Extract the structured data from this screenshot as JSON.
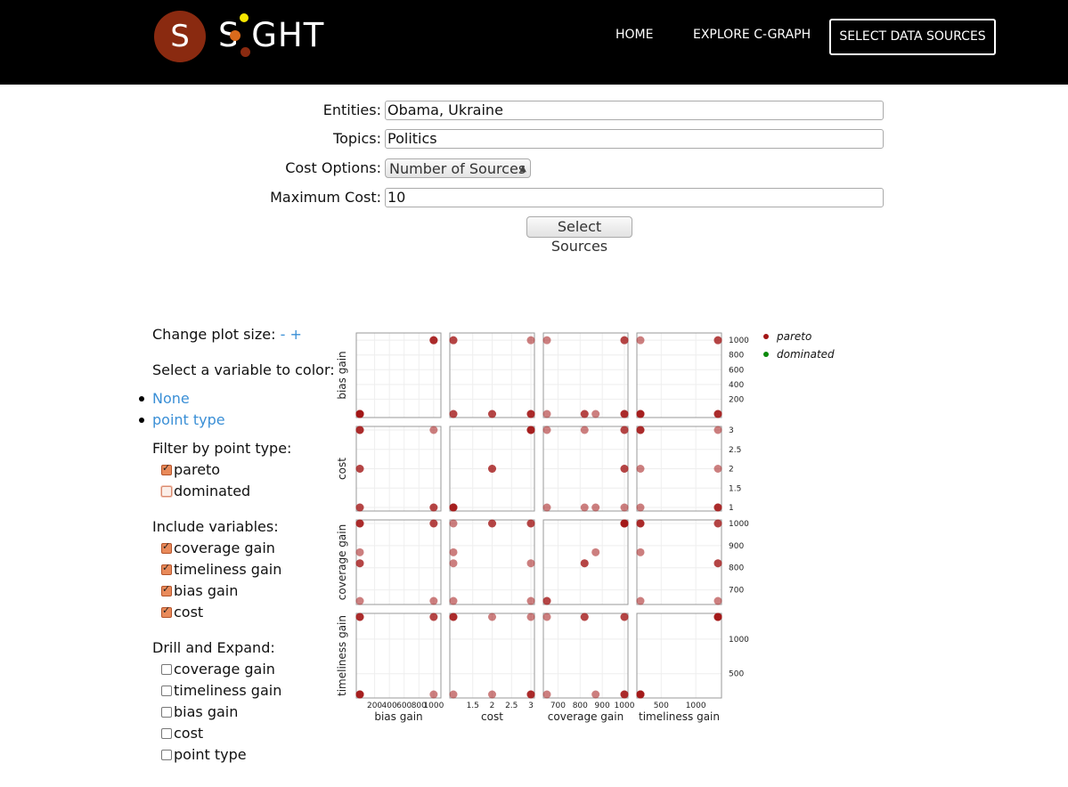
{
  "header": {
    "logo_letter": "S",
    "logo_text": "S GHT",
    "nav": [
      "HOME",
      "EXPLORE C-GRAPH",
      "SELECT DATA SOURCES"
    ]
  },
  "form": {
    "entities_label": "Entities:",
    "entities_value": "Obama, Ukraine",
    "topics_label": "Topics:",
    "topics_value": "Politics",
    "cost_label": "Cost Options:",
    "cost_value": "Number of Sources",
    "max_cost_label": "Maximum Cost:",
    "max_cost_value": "10",
    "submit_label": "Select Sources"
  },
  "controls": {
    "plot_size_label": "Change plot size:",
    "minus": "-",
    "plus": "+",
    "color_label": "Select a variable to color:",
    "color_options": [
      "None",
      "point type"
    ],
    "filter_label": "Filter by point type:",
    "filter_options": [
      {
        "label": "pareto",
        "checked": true
      },
      {
        "label": "dominated",
        "checked": false
      }
    ],
    "include_label": "Include variables:",
    "include_options": [
      {
        "label": "coverage gain",
        "checked": true
      },
      {
        "label": "timeliness gain",
        "checked": true
      },
      {
        "label": "bias gain",
        "checked": true
      },
      {
        "label": "cost",
        "checked": true
      }
    ],
    "drill_label": "Drill and Expand:",
    "drill_options": [
      {
        "label": "coverage gain",
        "checked": false
      },
      {
        "label": "timeliness gain",
        "checked": false
      },
      {
        "label": "bias gain",
        "checked": false
      },
      {
        "label": "cost",
        "checked": false
      },
      {
        "label": "point type",
        "checked": false
      }
    ]
  },
  "legend": [
    {
      "label": "pareto",
      "color": "#a31515"
    },
    {
      "label": "dominated",
      "color": "#0d8a0d"
    }
  ],
  "chart_data": {
    "type": "scatter",
    "variables": [
      "bias gain",
      "cost",
      "coverage gain",
      "timeliness gain"
    ],
    "ranges": [
      [
        0,
        1050
      ],
      [
        1,
        3
      ],
      [
        650,
        1000
      ],
      [
        200,
        1320
      ]
    ],
    "x_ticks": [
      [
        200,
        400,
        600,
        800,
        1000
      ],
      [
        1.5,
        2,
        2.5,
        3
      ],
      [
        700,
        800,
        900,
        1000
      ],
      [
        500,
        1000
      ]
    ],
    "y_ticks": [
      [
        200,
        400,
        600,
        800,
        1000
      ],
      [
        1,
        1.5,
        2,
        2.5,
        3
      ],
      [
        700,
        800,
        900,
        1000
      ],
      [
        500,
        1000
      ]
    ],
    "x_tick_labels": [
      [
        "200",
        "400",
        "600",
        "800",
        "1000"
      ],
      [
        "1.5",
        "2",
        "2.5",
        "3"
      ],
      [
        "700",
        "800",
        "900",
        "1000"
      ],
      [
        "500",
        "1000"
      ]
    ],
    "y_tick_labels": [
      [
        "200",
        "400",
        "600",
        "800",
        "1000"
      ],
      [
        "1",
        "1.5",
        "2",
        "2.5",
        "3"
      ],
      [
        "700",
        "800",
        "900",
        "1000"
      ],
      [
        "500",
        "1000"
      ]
    ],
    "pareto_color": "#a31515",
    "points": [
      {
        "bias gain": 1000,
        "cost": 1,
        "coverage gain": 1000,
        "timeliness gain": 1320,
        "point_type": "pareto"
      },
      {
        "bias gain": 0,
        "cost": 2,
        "coverage gain": 1000,
        "timeliness gain": 1320,
        "point_type": "pareto"
      },
      {
        "bias gain": 0,
        "cost": 3,
        "coverage gain": 650,
        "timeliness gain": 200,
        "point_type": "pareto"
      },
      {
        "bias gain": 1000,
        "cost": 3,
        "coverage gain": 1000,
        "timeliness gain": 200,
        "point_type": "pareto"
      },
      {
        "bias gain": 0,
        "cost": 2,
        "coverage gain": 1000,
        "timeliness gain": 200,
        "point_type": "pareto"
      },
      {
        "bias gain": 0,
        "cost": 3,
        "coverage gain": 1000,
        "timeliness gain": 200,
        "point_type": "pareto"
      },
      {
        "bias gain": 1000,
        "cost": 1,
        "coverage gain": 650,
        "timeliness gain": 1320,
        "point_type": "pareto"
      },
      {
        "bias gain": 0,
        "cost": 1,
        "coverage gain": 820,
        "timeliness gain": 1320,
        "point_type": "pareto"
      },
      {
        "bias gain": 0,
        "cost": 1,
        "coverage gain": 870,
        "timeliness gain": 200,
        "point_type": "pareto"
      },
      {
        "bias gain": 0,
        "cost": 3,
        "coverage gain": 820,
        "timeliness gain": 1320,
        "point_type": "pareto"
      }
    ]
  }
}
